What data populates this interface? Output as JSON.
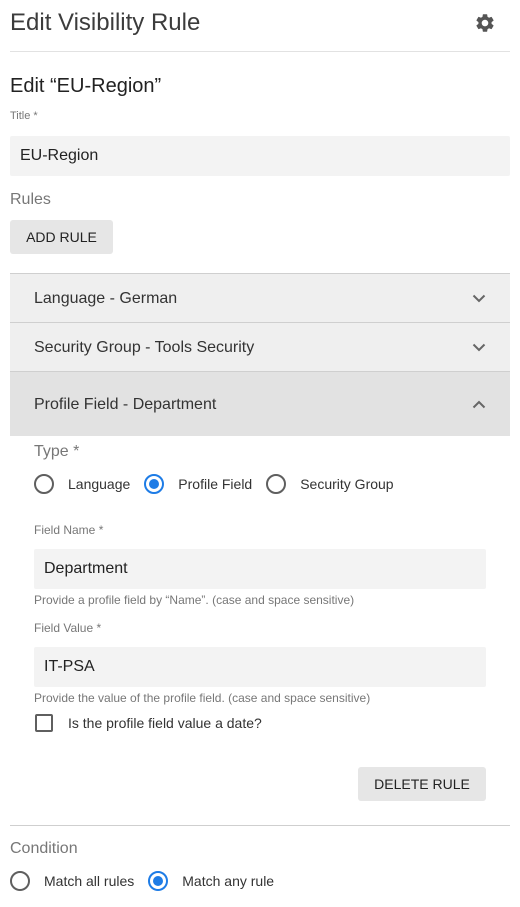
{
  "header": {
    "title": "Edit Visibility Rule",
    "settings_icon": "gear-icon"
  },
  "form": {
    "heading": "Edit “EU-Region”",
    "title_label": "Title *",
    "title_value": "EU-Region",
    "rules_label": "Rules",
    "add_rule_label": "ADD RULE"
  },
  "rules": [
    {
      "label": "Language - German",
      "expanded": false
    },
    {
      "label": "Security Group - Tools Security",
      "expanded": false
    },
    {
      "label": "Profile Field - Department",
      "expanded": true
    }
  ],
  "rule_detail": {
    "type_label": "Type *",
    "type_options": [
      "Language",
      "Profile Field",
      "Security Group"
    ],
    "type_selected": "Profile Field",
    "field_name_label": "Field Name *",
    "field_name_value": "Department",
    "field_name_helper": "Provide a profile field by “Name”. (case and space sensitive)",
    "field_value_label": "Field Value *",
    "field_value_value": "IT-PSA",
    "field_value_helper": "Provide the value of the profile field. (case and space sensitive)",
    "date_checkbox_label": "Is the profile field value a date?",
    "date_checkbox_checked": false,
    "delete_label": "DELETE RULE"
  },
  "condition": {
    "label": "Condition",
    "options": [
      "Match all rules",
      "Match any rule"
    ],
    "selected": "Match any rule"
  },
  "colors": {
    "accent": "#1e7ce6",
    "field_background": "#f3f3f3",
    "accordion_background": "#efefef",
    "accordion_expanded_background": "#e2e2e2"
  }
}
